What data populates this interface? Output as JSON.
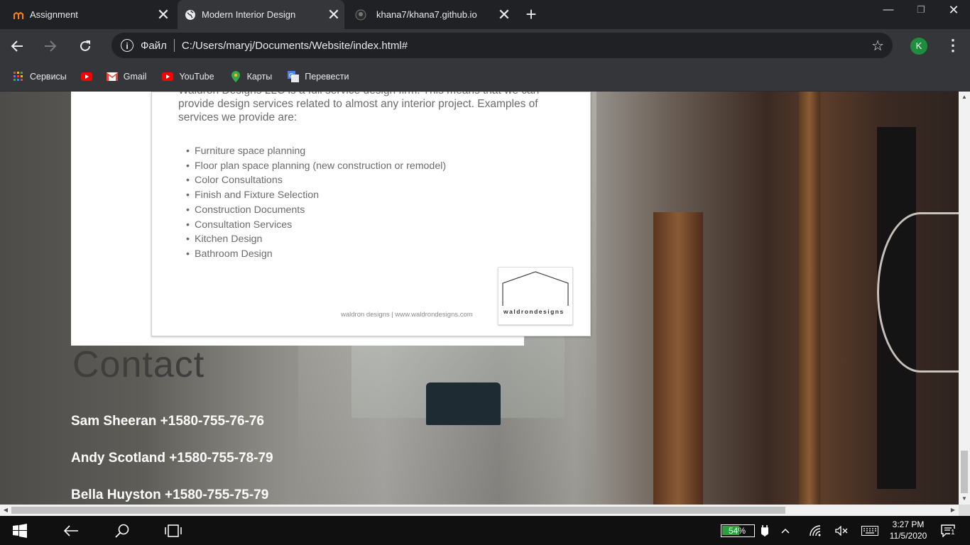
{
  "browser": {
    "tabs": [
      {
        "title": "Assignment",
        "active": false
      },
      {
        "title": "Modern Interior Design",
        "active": true
      },
      {
        "title": "khana7/khana7.github.io",
        "active": false
      }
    ],
    "new_tab_symbol": "+",
    "omnibox": {
      "scheme_label": "Файл",
      "url": "C:/Users/maryj/Documents/Website/index.html#"
    },
    "profile_initial": "K",
    "bookmarks": [
      {
        "label": "Сервисы",
        "icon": "apps-icon"
      },
      {
        "label": "",
        "icon": "youtube-icon"
      },
      {
        "label": "Gmail",
        "icon": "gmail-icon"
      },
      {
        "label": "YouTube",
        "icon": "youtube-icon"
      },
      {
        "label": "Карты",
        "icon": "maps-icon"
      },
      {
        "label": "Перевести",
        "icon": "translate-icon"
      }
    ]
  },
  "page": {
    "intro_text": "Waldron Designs LLC is a full service design firm. This means that we can provide design services related to almost any interior project. Examples of services we provide are:",
    "services": [
      "Furniture space planning",
      "Floor plan space planning (new construction or remodel)",
      "Color Consultations",
      "Finish and Fixture Selection",
      "Construction Documents",
      "Consultation Services",
      "Kitchen Design",
      "Bathroom Design"
    ],
    "doc_footer": "waldron designs | www.waldrondesigns.com",
    "logo_text": "waldrondesigns",
    "contact_heading": "Contact",
    "contacts": [
      "Sam Sheeran +1580-755-76-76",
      "Andy Scotland +1580-755-78-79",
      "Bella Huyston +1580-755-75-79"
    ]
  },
  "taskbar": {
    "battery_percent": "54%",
    "time": "3:27 PM",
    "date": "11/5/2020",
    "notification_count": "1"
  },
  "colors": {
    "chrome_dark": "#202124",
    "chrome_toolbar": "#35363a",
    "battery_green": "#2e9e3e",
    "avatar_green": "#1e8e3e"
  }
}
